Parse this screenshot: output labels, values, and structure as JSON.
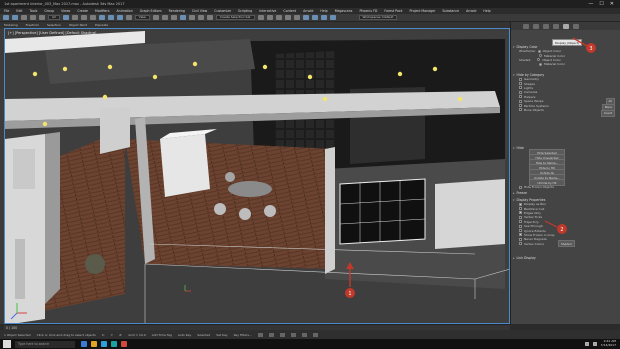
{
  "window": {
    "title": "1st apartment interior_003_Max 2017.max  -  Autodesk 3ds Max 2017",
    "controls": [
      "—",
      "☐",
      "✕"
    ]
  },
  "menubar": [
    "File",
    "Edit",
    "Tools",
    "Group",
    "Views",
    "Create",
    "Modifiers",
    "Animation",
    "Graph Editors",
    "Rendering",
    "Civil View",
    "Customize",
    "Scripting",
    "Interactive",
    "Content",
    "Arnold",
    "Help",
    "Megascans",
    "Phoenix FD",
    "Forest Pack",
    "Project Manager",
    "Substance",
    "Arnold",
    "Help"
  ],
  "toolbar": {
    "selection_filter": "All",
    "view_dropdown": "View",
    "selection_set": "Create Selection Set",
    "workspace": "Workspaces: Default"
  },
  "ribbon": [
    "Modeling",
    "Freeform",
    "Selection",
    "Object Paint",
    "Populate"
  ],
  "viewport": {
    "label": "[+] [Perspective] [User Defined] [Default Shading]"
  },
  "command_panel": {
    "tabs": [
      "create-tab",
      "modify-tab",
      "hierarchy-tab",
      "motion-tab",
      "display-tab",
      "utilities-tab"
    ],
    "active_tab": "display-tab",
    "tooltip": "Display (Object)",
    "display_color": {
      "title": "Display Color",
      "wireframe_label": "Wireframe:",
      "shaded_label": "Shaded:",
      "options": [
        "Object Color",
        "Material Color",
        "Object Color",
        "Material Color"
      ]
    },
    "hide_by_category": {
      "title": "Hide by Category",
      "items": [
        {
          "label": "Geometry",
          "checked": false
        },
        {
          "label": "Shapes",
          "checked": false
        },
        {
          "label": "Lights",
          "checked": false
        },
        {
          "label": "Cameras",
          "checked": false
        },
        {
          "label": "Helpers",
          "checked": false
        },
        {
          "label": "Space Warps",
          "checked": false
        },
        {
          "label": "Particle Systems",
          "checked": false
        },
        {
          "label": "Bone Objects",
          "checked": false
        }
      ],
      "side_buttons": [
        "All",
        "None",
        "Invert"
      ]
    },
    "hide": {
      "title": "Hide",
      "buttons": [
        "Hide Selected",
        "Hide Unselected",
        "Hide by Name...",
        "Hide by Hit",
        "Unhide All",
        "Unhide by Name...",
        "Unhide by Hit"
      ],
      "checkbox": "Hide Frozen Objects"
    },
    "freeze": {
      "title": "Freeze"
    },
    "display_properties": {
      "title": "Display Properties",
      "items": [
        {
          "label": "Display as Box",
          "checked": true
        },
        {
          "label": "Backface Cull",
          "checked": false
        },
        {
          "label": "Edges Only",
          "checked": true
        },
        {
          "label": "Vertex Ticks",
          "checked": false
        },
        {
          "label": "Trajectory",
          "checked": false
        },
        {
          "label": "See-Through",
          "checked": false
        },
        {
          "label": "Ignore Extents",
          "checked": false
        },
        {
          "label": "Show Frozen in Gray",
          "checked": true
        },
        {
          "label": "Never Degrade",
          "checked": false
        },
        {
          "label": "Vertex Colors",
          "checked": false
        }
      ],
      "shaded_button": "Shaded"
    },
    "link_display": {
      "title": "Link Display"
    }
  },
  "callouts": [
    "1",
    "2",
    "3"
  ],
  "timeline": {
    "range": "0 / 100"
  },
  "statusbar": {
    "selection": "1 Object Selected",
    "prompt": "Click or click-and-drag to select objects",
    "x": "X:",
    "y": "Y:",
    "z": "Z:",
    "grid": "Grid = 10.0",
    "add_time_tag": "Add Time Tag",
    "auto_key": "Auto Key",
    "selected": "Selected",
    "set_key": "Set Key",
    "key_filters": "Key Filters..."
  },
  "taskbar": {
    "search": "Type here to search",
    "time": "9:41 AM",
    "date": "7/14/2017"
  },
  "colors": {
    "callout": "#c0392b",
    "floor": "#6e4430",
    "wall": "#d8d8d8",
    "viewport_bg": "#3e3e3e",
    "panel_bg": "#444444"
  }
}
